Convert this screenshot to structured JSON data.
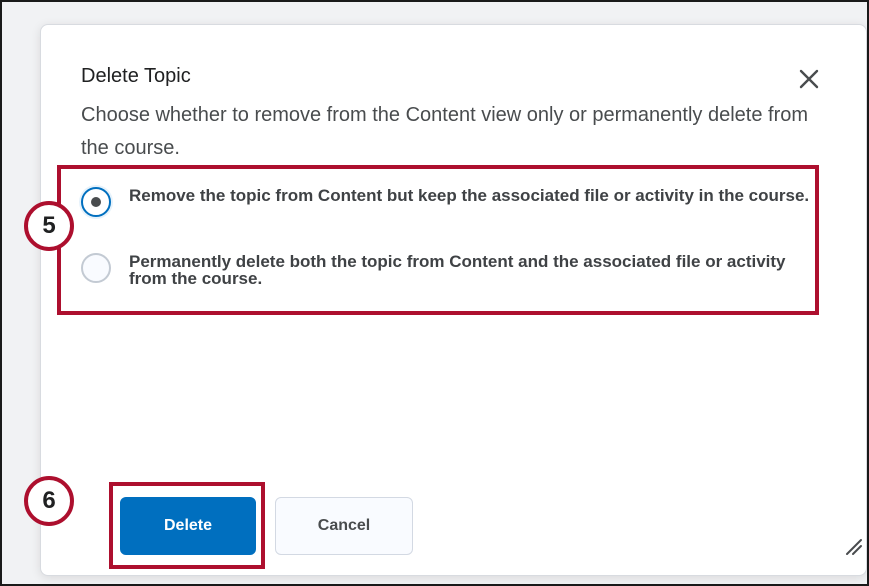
{
  "dialog": {
    "title": "Delete Topic",
    "close_icon": "close-icon",
    "description": "Choose whether to remove from the Content view only or permanently delete from the course.",
    "options": [
      {
        "label": "Remove the topic from Content but keep the associated file or activity in the course.",
        "selected": true
      },
      {
        "label": "Permanently delete both the topic from Content and the associated file or activity from the course.",
        "selected": false
      }
    ],
    "buttons": {
      "delete_label": "Delete",
      "cancel_label": "Cancel"
    },
    "resize_icon": "resize-handle-icon"
  },
  "annotations": {
    "step_5": "5",
    "step_6": "6",
    "highlight_color": "#ad0f2e"
  },
  "colors": {
    "primary": "#006fbf",
    "text": "#494c4e"
  }
}
